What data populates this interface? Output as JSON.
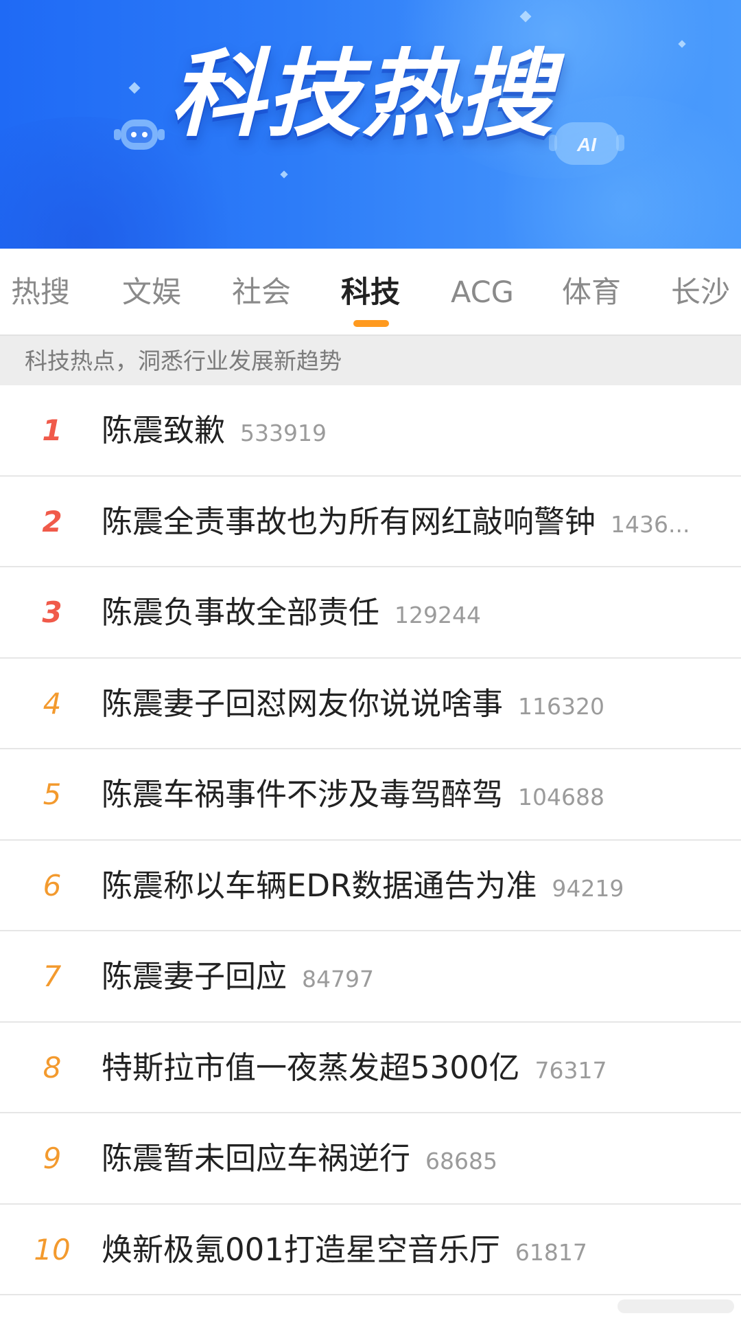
{
  "banner": {
    "title": "科技热搜",
    "ai_badge": "AI",
    "colors": {
      "top": "#1f6af5",
      "bottom": "#4a9bfc"
    }
  },
  "tabs": [
    {
      "label": "热搜",
      "active": false
    },
    {
      "label": "文娱",
      "active": false
    },
    {
      "label": "社会",
      "active": false
    },
    {
      "label": "科技",
      "active": true
    },
    {
      "label": "ACG",
      "active": false
    },
    {
      "label": "体育",
      "active": false
    },
    {
      "label": "长沙",
      "active": false
    }
  ],
  "subheader": {
    "text": "科技热点，洞悉行业发展新趋势"
  },
  "list": [
    {
      "rank": "1",
      "title": "陈震致歉",
      "count": "533919"
    },
    {
      "rank": "2",
      "title": "陈震全责事故也为所有网红敲响警钟",
      "count": "1436..."
    },
    {
      "rank": "3",
      "title": "陈震负事故全部责任",
      "count": "129244"
    },
    {
      "rank": "4",
      "title": "陈震妻子回怼网友你说说啥事",
      "count": "116320"
    },
    {
      "rank": "5",
      "title": "陈震车祸事件不涉及毒驾醉驾",
      "count": "104688"
    },
    {
      "rank": "6",
      "title": "陈震称以车辆EDR数据通告为准",
      "count": "94219"
    },
    {
      "rank": "7",
      "title": "陈震妻子回应",
      "count": "84797"
    },
    {
      "rank": "8",
      "title": "特斯拉市值一夜蒸发超5300亿",
      "count": "76317"
    },
    {
      "rank": "9",
      "title": "陈震暂未回应车祸逆行",
      "count": "68685"
    },
    {
      "rank": "10",
      "title": "焕新极氪001打造星空音乐厅",
      "count": "61817"
    }
  ],
  "colors": {
    "rank_top": "#f05a4a",
    "rank_other": "#f39a2e",
    "tab_indicator": "#ff9a1f"
  }
}
